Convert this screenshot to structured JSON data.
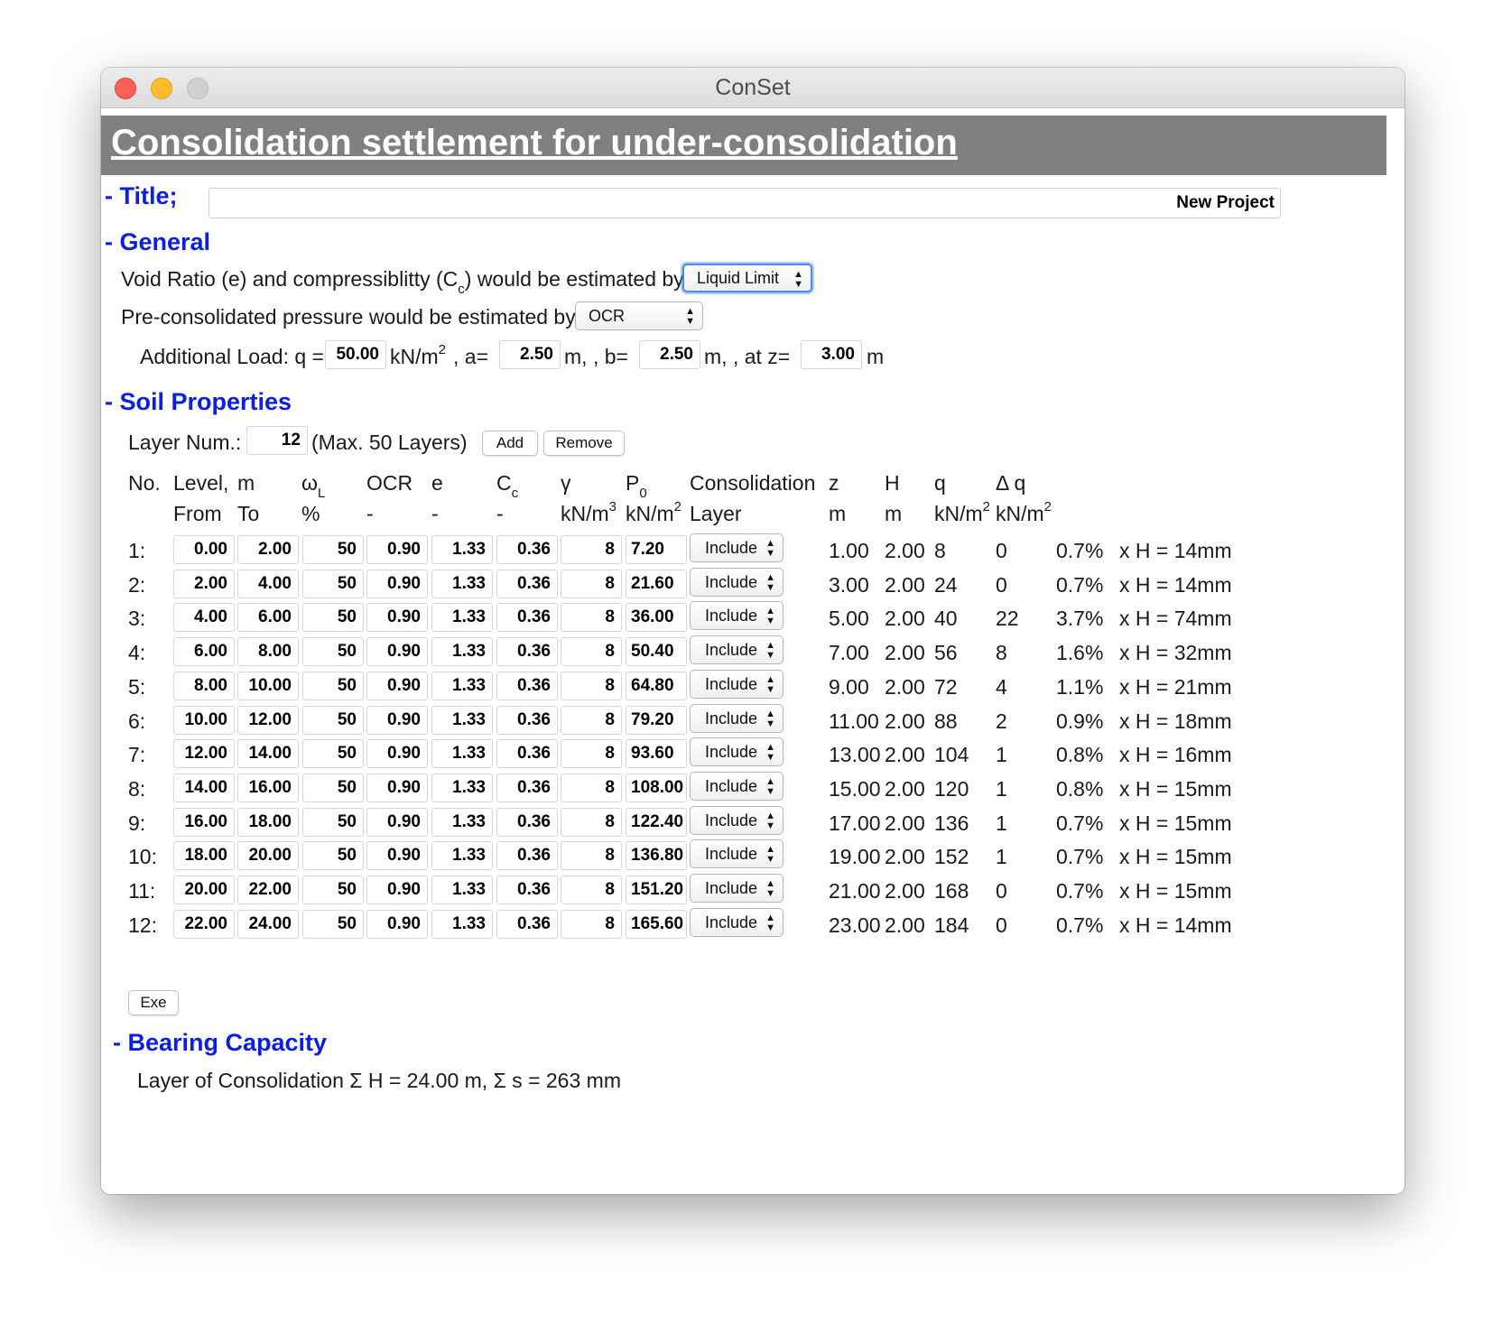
{
  "window": {
    "title": "ConSet"
  },
  "banner": {
    "heading": "Consolidation settlement for under-consolidation"
  },
  "title_section": {
    "label": "- Title;",
    "value": "New Project"
  },
  "general": {
    "label": "- General",
    "void_ratio_prefix": "Void Ratio (e) and compressiblitty (C",
    "void_ratio_sub": "c",
    "void_ratio_suffix": ") would be estimated by",
    "void_ratio_method": "Liquid Limit",
    "preconsolidated_label": "Pre-consolidated pressure would be estimated by",
    "preconsolidated_method": "OCR",
    "additional_load": {
      "prefix": "Additional Load: q =",
      "q": "50.00",
      "q_unit": "kN/m",
      "q_unit_sup": "2",
      "a_label": ",  a=",
      "a": "2.50",
      "a_unit": "m, ,  b=",
      "b": "2.50",
      "b_unit": "m, ,  at z=",
      "z": "3.00",
      "z_unit": "m"
    }
  },
  "soil": {
    "label": "- Soil Properties",
    "layer_num_label": "Layer Num.:",
    "layer_num": "12",
    "max_layers": "(Max. 50 Layers)",
    "add_label": "Add",
    "remove_label": "Remove",
    "headers": {
      "no": "No.",
      "level": "Level,",
      "m": "m",
      "from": "From",
      "to": "To",
      "wl": "ω",
      "wl_sub": "L",
      "wl_unit": "%",
      "ocr": "OCR",
      "ocr_unit": "-",
      "e": "e",
      "e_unit": "-",
      "cc": "C",
      "cc_sub": "c",
      "cc_unit": "-",
      "gamma": "γ",
      "gamma_unit": "kN/m",
      "gamma_unit_sup": "3",
      "p0": "P",
      "p0_sub": "0",
      "p0_unit": "kN/m",
      "p0_unit_sup": "2",
      "consolidation": "Consolidation",
      "layer": "Layer",
      "z": "z",
      "z_unit": "m",
      "h": "H",
      "h_unit": "m",
      "q": "q",
      "q_unit": "kN/m",
      "q_unit_sup": "2",
      "dq": "Δ q",
      "dq_unit": "kN/m",
      "dq_unit_sup": "2"
    },
    "rows": [
      {
        "no": "1:",
        "from": "0.00",
        "to": "2.00",
        "wl": "50",
        "ocr": "0.90",
        "e": "1.33",
        "cc": "0.36",
        "gamma": "8",
        "p0": "7.20",
        "consol": "Include",
        "z": "1.00",
        "h": "2.00",
        "q": "8",
        "dq": "0",
        "pct": "0.7%",
        "xh": "x H = 14mm"
      },
      {
        "no": "2:",
        "from": "2.00",
        "to": "4.00",
        "wl": "50",
        "ocr": "0.90",
        "e": "1.33",
        "cc": "0.36",
        "gamma": "8",
        "p0": "21.60",
        "consol": "Include",
        "z": "3.00",
        "h": "2.00",
        "q": "24",
        "dq": "0",
        "pct": "0.7%",
        "xh": "x H = 14mm"
      },
      {
        "no": "3:",
        "from": "4.00",
        "to": "6.00",
        "wl": "50",
        "ocr": "0.90",
        "e": "1.33",
        "cc": "0.36",
        "gamma": "8",
        "p0": "36.00",
        "consol": "Include",
        "z": "5.00",
        "h": "2.00",
        "q": "40",
        "dq": "22",
        "pct": "3.7%",
        "xh": "x H = 74mm"
      },
      {
        "no": "4:",
        "from": "6.00",
        "to": "8.00",
        "wl": "50",
        "ocr": "0.90",
        "e": "1.33",
        "cc": "0.36",
        "gamma": "8",
        "p0": "50.40",
        "consol": "Include",
        "z": "7.00",
        "h": "2.00",
        "q": "56",
        "dq": "8",
        "pct": "1.6%",
        "xh": "x H = 32mm"
      },
      {
        "no": "5:",
        "from": "8.00",
        "to": "10.00",
        "wl": "50",
        "ocr": "0.90",
        "e": "1.33",
        "cc": "0.36",
        "gamma": "8",
        "p0": "64.80",
        "consol": "Include",
        "z": "9.00",
        "h": "2.00",
        "q": "72",
        "dq": "4",
        "pct": "1.1%",
        "xh": "x H = 21mm"
      },
      {
        "no": "6:",
        "from": "10.00",
        "to": "12.00",
        "wl": "50",
        "ocr": "0.90",
        "e": "1.33",
        "cc": "0.36",
        "gamma": "8",
        "p0": "79.20",
        "consol": "Include",
        "z": "11.00",
        "h": "2.00",
        "q": "88",
        "dq": "2",
        "pct": "0.9%",
        "xh": "x H = 18mm"
      },
      {
        "no": "7:",
        "from": "12.00",
        "to": "14.00",
        "wl": "50",
        "ocr": "0.90",
        "e": "1.33",
        "cc": "0.36",
        "gamma": "8",
        "p0": "93.60",
        "consol": "Include",
        "z": "13.00",
        "h": "2.00",
        "q": "104",
        "dq": "1",
        "pct": "0.8%",
        "xh": "x H = 16mm"
      },
      {
        "no": "8:",
        "from": "14.00",
        "to": "16.00",
        "wl": "50",
        "ocr": "0.90",
        "e": "1.33",
        "cc": "0.36",
        "gamma": "8",
        "p0": "108.00",
        "consol": "Include",
        "z": "15.00",
        "h": "2.00",
        "q": "120",
        "dq": "1",
        "pct": "0.8%",
        "xh": "x H = 15mm"
      },
      {
        "no": "9:",
        "from": "16.00",
        "to": "18.00",
        "wl": "50",
        "ocr": "0.90",
        "e": "1.33",
        "cc": "0.36",
        "gamma": "8",
        "p0": "122.40",
        "consol": "Include",
        "z": "17.00",
        "h": "2.00",
        "q": "136",
        "dq": "1",
        "pct": "0.7%",
        "xh": "x H = 15mm"
      },
      {
        "no": "10:",
        "from": "18.00",
        "to": "20.00",
        "wl": "50",
        "ocr": "0.90",
        "e": "1.33",
        "cc": "0.36",
        "gamma": "8",
        "p0": "136.80",
        "consol": "Include",
        "z": "19.00",
        "h": "2.00",
        "q": "152",
        "dq": "1",
        "pct": "0.7%",
        "xh": "x H = 15mm"
      },
      {
        "no": "11:",
        "from": "20.00",
        "to": "22.00",
        "wl": "50",
        "ocr": "0.90",
        "e": "1.33",
        "cc": "0.36",
        "gamma": "8",
        "p0": "151.20",
        "consol": "Include",
        "z": "21.00",
        "h": "2.00",
        "q": "168",
        "dq": "0",
        "pct": "0.7%",
        "xh": "x H = 15mm"
      },
      {
        "no": "12:",
        "from": "22.00",
        "to": "24.00",
        "wl": "50",
        "ocr": "0.90",
        "e": "1.33",
        "cc": "0.36",
        "gamma": "8",
        "p0": "165.60",
        "consol": "Include",
        "z": "23.00",
        "h": "2.00",
        "q": "184",
        "dq": "0",
        "pct": "0.7%",
        "xh": "x H = 14mm"
      }
    ],
    "exe_label": "Exe"
  },
  "bearing": {
    "label": "- Bearing Capacity",
    "summary": "Layer of Consolidation Σ H = 24.00 m,   Σ s = 263 mm"
  },
  "colors": {
    "section_heading": "#0a1ee6",
    "banner": "#808080",
    "focus_ring": "#4a8bf5"
  }
}
